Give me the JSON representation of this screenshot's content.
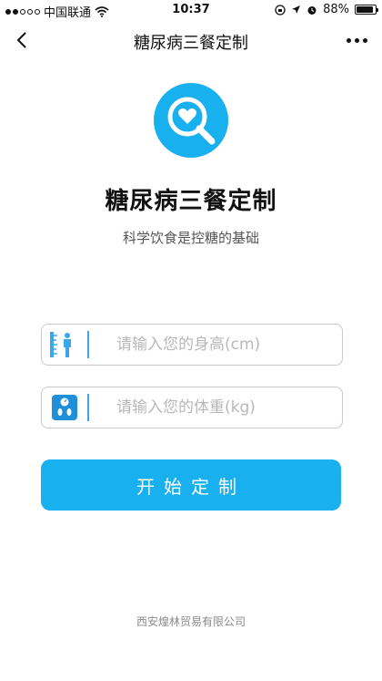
{
  "status_bar": {
    "carrier": "中国联通",
    "time": "10:37",
    "battery": "88%",
    "battery_level": 0.88
  },
  "nav": {
    "title": "糖尿病三餐定制"
  },
  "header": {
    "title": "糖尿病三餐定制",
    "subtitle": "科学饮食是控糖的基础",
    "accent_color": "#19b0f0"
  },
  "form": {
    "height_placeholder": "请输入您的身高(cm)",
    "weight_placeholder": "请输入您的体重(kg)",
    "submit_label": "开始定制"
  },
  "footer": {
    "company": "西安煌林贸易有限公司"
  }
}
